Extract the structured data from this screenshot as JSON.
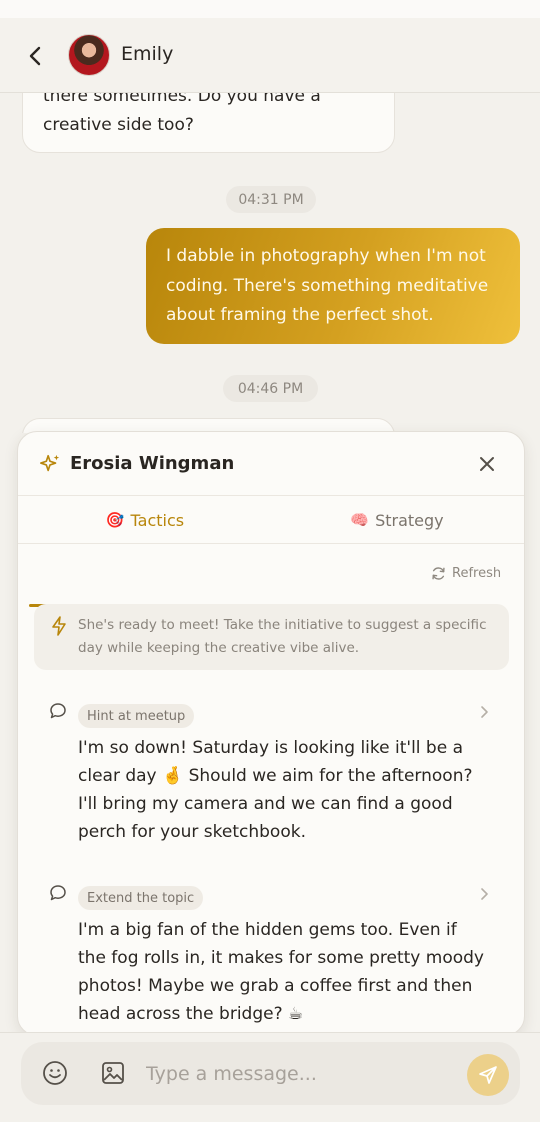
{
  "header": {
    "contact_name": "Emily"
  },
  "chat": {
    "incoming_partial": "there sometimes. Do you have a creative side too?",
    "timestamp_1": "04:31 PM",
    "outgoing": "I dabble in photography when I'm not coding. There's something meditative about framing the perfect shot.",
    "timestamp_2": "04:46 PM"
  },
  "wingman": {
    "title": "Erosia Wingman",
    "tabs": [
      {
        "emoji": "🎯",
        "label": "Tactics",
        "active": true
      },
      {
        "emoji": "🧠",
        "label": "Strategy",
        "active": false
      }
    ],
    "refresh_label": "Refresh",
    "insight": "She's ready to meet! Take the initiative to suggest a specific day while keeping the creative vibe alive.",
    "suggestions": [
      {
        "tag": "Hint at meetup",
        "text": "I'm so down! Saturday is looking like it'll be a clear day 🤞 Should we aim for the afternoon? I'll bring my camera and we can find a good perch for your sketchbook."
      },
      {
        "tag": "Extend the topic",
        "text": "I'm a big fan of the hidden gems too. Even if the fog rolls in, it makes for some pretty moody photos! Maybe we grab a coffee first and then head across the bridge? ☕"
      }
    ]
  },
  "composer": {
    "placeholder": "Type a message..."
  },
  "colors": {
    "accent": "#b8860b",
    "background": "#f3f1ec",
    "send_button": "#ecd08a"
  }
}
